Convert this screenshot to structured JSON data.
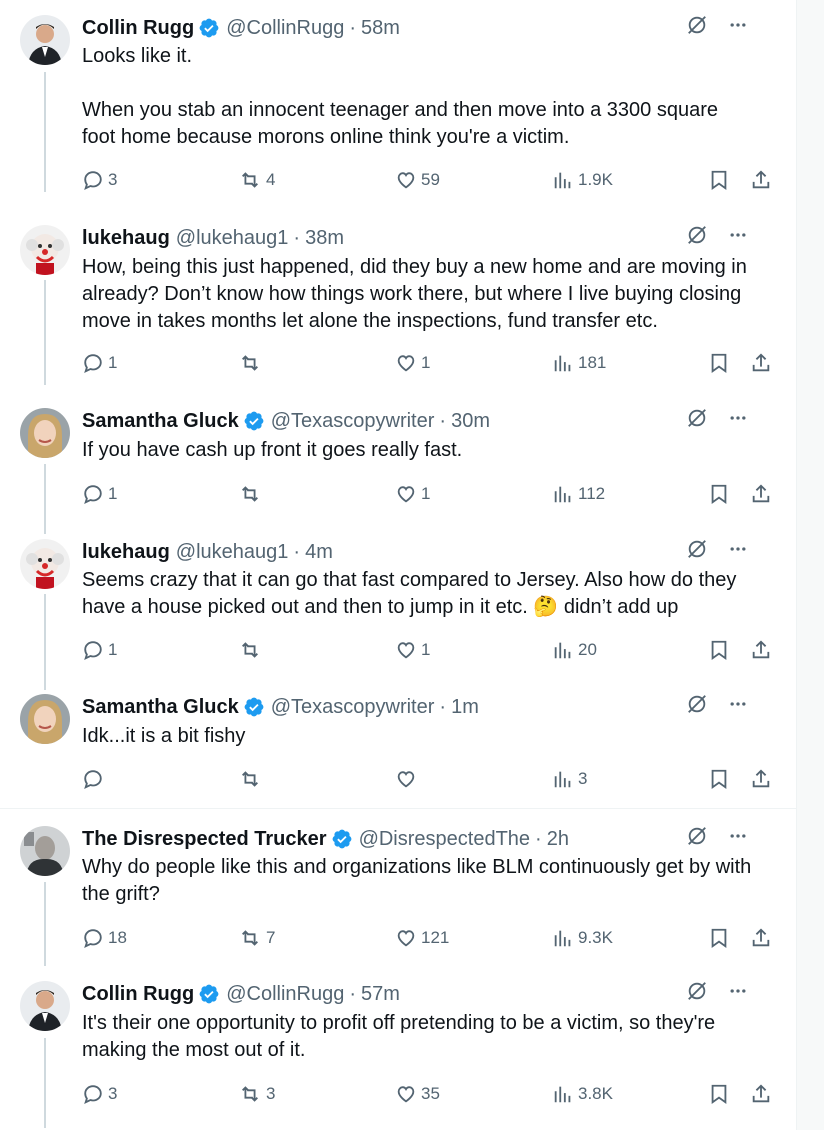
{
  "tweets": [
    {
      "name": "Collin Rugg",
      "verified": true,
      "handle": "@CollinRugg",
      "time": "58m",
      "lines": [
        "Looks like it.",
        "",
        "When you stab an innocent teenager and then move into a 3300 square",
        "foot home because morons online think you're a victim."
      ],
      "replies": "3",
      "retweets": "4",
      "likes": "59",
      "views": "1.9K"
    },
    {
      "name": "lukehaug",
      "verified": false,
      "handle": "@lukehaug1",
      "time": "38m",
      "lines": [
        "How, being this just happened, did they buy a new home and are moving in",
        "already? Don’t know how things work there, but where I live buying closing",
        "move in takes months let alone the inspections, fund transfer etc."
      ],
      "replies": "1",
      "retweets": "",
      "likes": "1",
      "views": "181"
    },
    {
      "name": "Samantha Gluck",
      "verified": true,
      "handle": "@Texascopywriter",
      "time": "30m",
      "lines": [
        "If you have cash up front it goes really fast."
      ],
      "replies": "1",
      "retweets": "",
      "likes": "1",
      "views": "112"
    },
    {
      "name": "lukehaug",
      "verified": false,
      "handle": "@lukehaug1",
      "time": "4m",
      "lines": [
        "Seems crazy that it can go that fast compared to Jersey. Also how do they",
        "have a house picked out and then to jump in it etc. 🤔 didn’t add up"
      ],
      "replies": "1",
      "retweets": "",
      "likes": "1",
      "views": "20"
    },
    {
      "name": "Samantha Gluck",
      "verified": true,
      "handle": "@Texascopywriter",
      "time": "1m",
      "lines": [
        "Idk...it is a bit fishy"
      ],
      "replies": "",
      "retweets": "",
      "likes": "",
      "views": "3"
    },
    {
      "name": "The Disrespected Trucker",
      "verified": true,
      "handle": "@DisrespectedThe",
      "time": "2h",
      "lines": [
        "Why do people like this and organizations like BLM continuously get by with",
        "the grift?"
      ],
      "replies": "18",
      "retweets": "7",
      "likes": "121",
      "views": "9.3K"
    },
    {
      "name": "Collin Rugg",
      "verified": true,
      "handle": "@CollinRugg",
      "time": "57m",
      "lines": [
        "It's their one opportunity to profit off pretending to be a victim, so they're",
        "making the most out of it."
      ],
      "replies": "3",
      "retweets": "3",
      "likes": "35",
      "views": "3.8K"
    }
  ],
  "colors": {
    "verified": "#1d9bf0",
    "muted": "#536471",
    "text": "#0f1419",
    "thread_line": "#cfd9de"
  },
  "icons": {
    "header": [
      "grok-icon",
      "more-icon"
    ],
    "actions": [
      "reply-icon",
      "retweet-icon",
      "like-icon",
      "views-icon",
      "bookmark-icon",
      "share-icon"
    ]
  }
}
